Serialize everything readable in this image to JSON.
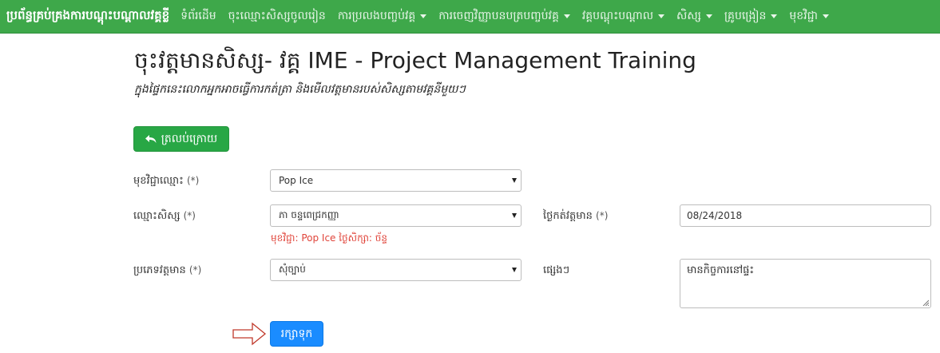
{
  "nav": {
    "brand": "ប្រព័ន្ធគ្រប់គ្រងការបណ្តុះបណ្តាលវគ្គខ្លី",
    "items": [
      {
        "label": "ទំព័រដើម",
        "has_dropdown": false
      },
      {
        "label": "ចុះឈ្មោះសិស្សចូលរៀន",
        "has_dropdown": false
      },
      {
        "label": "ការប្រលងបញ្ចប់វគ្គ",
        "has_dropdown": true
      },
      {
        "label": "ការចេញវិញ្ញាបនបត្របញ្ចប់វគ្គ",
        "has_dropdown": true
      },
      {
        "label": "វគ្គបណ្តុះបណ្តាល",
        "has_dropdown": true
      },
      {
        "label": "សិស្ស",
        "has_dropdown": true
      },
      {
        "label": "គ្រូបង្រៀន",
        "has_dropdown": true
      },
      {
        "label": "មុខវិជ្ជា",
        "has_dropdown": true
      }
    ],
    "bg_color": "#3ea84a"
  },
  "header": {
    "title": "ចុះវត្តមានសិស្ស- វគ្គ IME - Project Management Training",
    "subtitle": "ក្នុងផ្ទៃកនេះលោកអ្នកអាចធ្វើការកត់ត្រា និងមើលវត្តមានរបស់សិស្សតាមវគ្គនីមួយៗ"
  },
  "buttons": {
    "back_label": "ត្រលប់ក្រោយ",
    "back_icon": "reply-arrow-icon",
    "save_label": "រក្សាទុក"
  },
  "form": {
    "subject": {
      "label": "មុខវិជ្ជាឈ្មោះ",
      "required_mark": "(*)",
      "value": "Pop Ice"
    },
    "student": {
      "label": "ឈ្មោះសិស្ស",
      "required_mark": "(*)",
      "value": "ភា ចន្ទពេជ្រកញ្ញា",
      "help": "មុខវិជ្ជា: Pop Ice ថ្ងៃសិក្សា: ច័ន្ទ"
    },
    "date": {
      "label": "ថ្ងៃកត់វត្តមាន",
      "required_mark": "(*)",
      "value": "08/24/2018"
    },
    "type": {
      "label": "ប្រភេទវត្តមាន",
      "required_mark": "(*)",
      "value": "សុំច្បាប់"
    },
    "other": {
      "label": "ផ្សេងៗ",
      "value": "មានកិច្ចការនៅផ្ទះ"
    }
  },
  "colors": {
    "back_button": "#28a745",
    "save_button": "#1a8cff",
    "help_text": "#e0443a",
    "pointer_arrow": "#c0392b"
  }
}
